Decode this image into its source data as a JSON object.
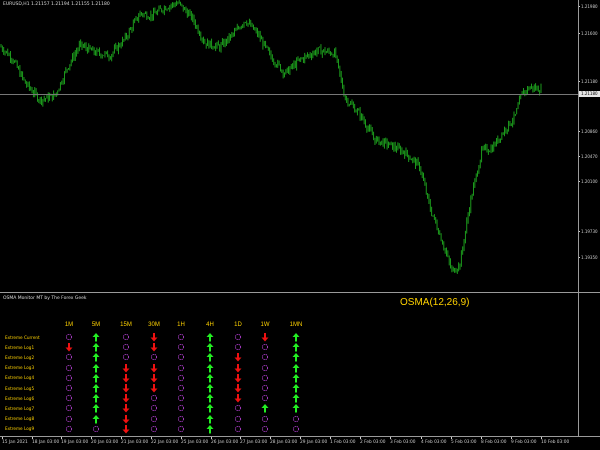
{
  "chart": {
    "symbol_info": "EURUSD,H1  1.21157 1.21194 1.21155 1.21180",
    "current_price_label": "1.21180",
    "candle_color": "#1faa1f",
    "y_ticks": [
      "1.21980",
      "1.21600",
      "1.21180",
      "1.20860",
      "1.20470",
      "1.20100",
      "1.19730",
      "1.19350"
    ],
    "x_ticks": [
      "15 Jan 2021",
      "18 Jan 03:00",
      "19 Jan 03:00",
      "20 Jan 03:00",
      "21 Jan 03:00",
      "22 Jan 03:00",
      "25 Jan 03:00",
      "26 Jan 03:00",
      "27 Jan 03:00",
      "28 Jan 03:00",
      "29 Jan 03:00",
      "1 Feb 03:00",
      "2 Feb 03:00",
      "3 Feb 03:00",
      "4 Feb 03:00",
      "5 Feb 03:00",
      "8 Feb 03:00",
      "9 Feb 03:00",
      "10 Feb 03:00"
    ],
    "price_path": [
      [
        0,
        1.2159
      ],
      [
        12,
        1.2148
      ],
      [
        25,
        1.2124
      ],
      [
        40,
        1.2108
      ],
      [
        55,
        1.2112
      ],
      [
        68,
        1.214
      ],
      [
        80,
        1.216
      ],
      [
        95,
        1.2153
      ],
      [
        110,
        1.215
      ],
      [
        125,
        1.2166
      ],
      [
        140,
        1.219
      ],
      [
        152,
        1.2188
      ],
      [
        165,
        1.2196
      ],
      [
        178,
        1.22
      ],
      [
        192,
        1.2186
      ],
      [
        205,
        1.2162
      ],
      [
        220,
        1.2158
      ],
      [
        235,
        1.2172
      ],
      [
        245,
        1.2184
      ],
      [
        258,
        1.217
      ],
      [
        270,
        1.215
      ],
      [
        285,
        1.2133
      ],
      [
        300,
        1.2146
      ],
      [
        318,
        1.2155
      ],
      [
        335,
        1.2152
      ],
      [
        345,
        1.211
      ],
      [
        360,
        1.2094
      ],
      [
        375,
        1.207
      ],
      [
        390,
        1.2065
      ],
      [
        405,
        1.2058
      ],
      [
        420,
        1.2044
      ],
      [
        430,
        1.2005
      ],
      [
        440,
        1.198
      ],
      [
        452,
        1.1945
      ],
      [
        460,
        1.1952
      ],
      [
        470,
        1.201
      ],
      [
        482,
        1.206
      ],
      [
        492,
        1.2062
      ],
      [
        505,
        1.208
      ],
      [
        515,
        1.2092
      ],
      [
        522,
        1.2114
      ],
      [
        530,
        1.212
      ],
      [
        540,
        1.2118
      ]
    ]
  },
  "indicator": {
    "panel_title": "OSMA Monitor MT by The Forex Geek",
    "title": "OSMA(12,26,9)",
    "colors": {
      "up": "#22ee22",
      "down": "#ee1111",
      "neutral": "#b03fcf",
      "label": "#ffd200"
    },
    "timeframes": [
      "1M",
      "5M",
      "15M",
      "30M",
      "1H",
      "4H",
      "1D",
      "1W",
      "1MN"
    ],
    "rows": [
      {
        "label": "Extreme Current",
        "states": [
          "neutral",
          "up",
          "neutral",
          "down",
          "neutral",
          "up",
          "neutral",
          "down",
          "up"
        ]
      },
      {
        "label": "Extreme Log1",
        "states": [
          "down",
          "up",
          "neutral",
          "down",
          "neutral",
          "up",
          "neutral",
          "neutral",
          "up"
        ]
      },
      {
        "label": "Extreme Log2",
        "states": [
          "neutral",
          "up",
          "neutral",
          "neutral",
          "neutral",
          "up",
          "down",
          "neutral",
          "up"
        ]
      },
      {
        "label": "Extreme Log3",
        "states": [
          "neutral",
          "up",
          "down",
          "down",
          "neutral",
          "up",
          "down",
          "neutral",
          "up"
        ]
      },
      {
        "label": "Extreme Log4",
        "states": [
          "neutral",
          "up",
          "down",
          "down",
          "neutral",
          "up",
          "down",
          "neutral",
          "up"
        ]
      },
      {
        "label": "Extreme Log5",
        "states": [
          "neutral",
          "up",
          "down",
          "down",
          "neutral",
          "up",
          "down",
          "neutral",
          "up"
        ]
      },
      {
        "label": "Extreme Log6",
        "states": [
          "neutral",
          "up",
          "down",
          "neutral",
          "neutral",
          "up",
          "down",
          "neutral",
          "up"
        ]
      },
      {
        "label": "Extreme Log7",
        "states": [
          "neutral",
          "up",
          "down",
          "neutral",
          "neutral",
          "up",
          "neutral",
          "up",
          "up"
        ]
      },
      {
        "label": "Extreme Log8",
        "states": [
          "neutral",
          "up",
          "down",
          "neutral",
          "neutral",
          "up",
          "neutral",
          "neutral",
          "neutral"
        ]
      },
      {
        "label": "Extreme Log9",
        "states": [
          "neutral",
          "neutral",
          "down",
          "neutral",
          "neutral",
          "up",
          "neutral",
          "neutral",
          "neutral"
        ]
      }
    ]
  }
}
